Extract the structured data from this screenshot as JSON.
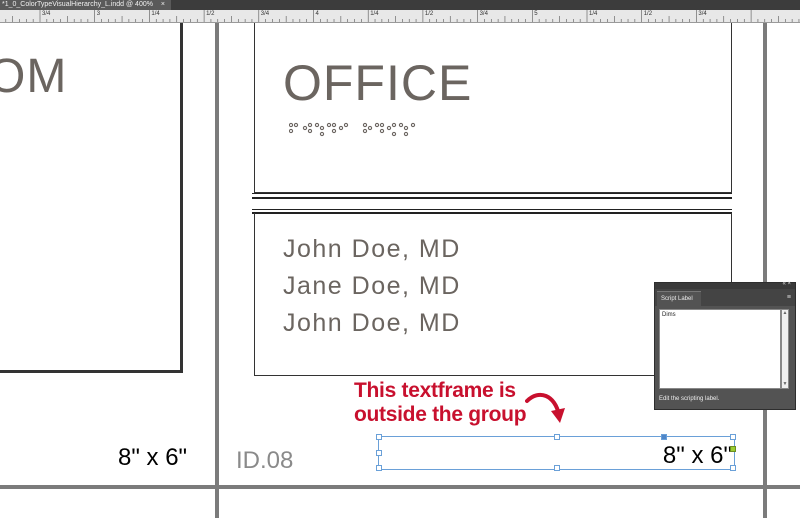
{
  "document_tab": {
    "title": "*1_0_ColorTypeVisualHierarchy_L.indd @ 400%",
    "close_glyph": "×"
  },
  "ruler": {
    "labels": [
      "3/4",
      "3",
      "1/4",
      "1/2",
      "3/4",
      "4",
      "1/4",
      "1/2",
      "3/4",
      "5",
      "1/4",
      "1/2",
      "3/4"
    ]
  },
  "canvas": {
    "left_sign_text": "OM",
    "left_size_label": "8\" x 6\"",
    "sign_id": "ID.08",
    "sign_title": "OFFICE",
    "names": [
      "John Doe, MD",
      "Jane Doe, MD",
      "John Doe, MD"
    ],
    "annotation_lines": [
      "This textframe is",
      "outside the group"
    ],
    "frame_text": "8\" x 6\""
  },
  "script_panel": {
    "header_buttons": "«  ×",
    "tab_label": "Script Label",
    "menu_glyph": "≡",
    "content": "Dims",
    "hint": "Edit the scripting label."
  },
  "colors": {
    "sign_text": "#6b6560",
    "annotation": "#c8102e",
    "selection": "#6aa0d8",
    "panel_bg": "#535353"
  }
}
